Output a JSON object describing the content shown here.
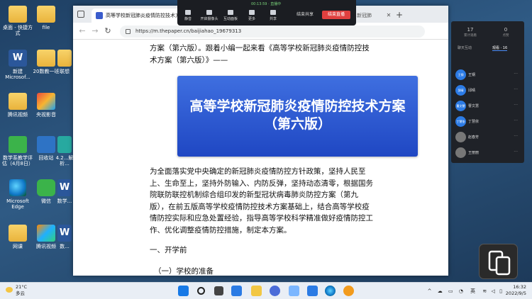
{
  "desktop": {
    "icons": [
      {
        "label": "桌面 - 快捷方式",
        "type": "folder"
      },
      {
        "label": "file",
        "type": "folder"
      },
      {
        "label": "新建 Microsof...",
        "type": "word"
      },
      {
        "label": "20数教一班",
        "type": "folder"
      },
      {
        "label": "联想",
        "type": "folder"
      },
      {
        "label": "腾讯视频",
        "type": "folder"
      },
      {
        "label": "央视影音",
        "type": "app"
      },
      {
        "label": "数学系教学评估（4月8日）",
        "type": "green"
      },
      {
        "label": "回收站",
        "type": "recycle"
      },
      {
        "label": "4.2...解析...",
        "type": "teal"
      },
      {
        "label": "Microsoft Edge",
        "type": "edge"
      },
      {
        "label": "微信",
        "type": "green"
      },
      {
        "label": "数学...",
        "type": "word"
      },
      {
        "label": "网课",
        "type": "folder"
      },
      {
        "label": "腾讯视频",
        "type": "app"
      },
      {
        "label": "数...",
        "type": "word"
      }
    ]
  },
  "browser": {
    "tab_title": "高等学校新冠肺炎疫情防控技术方案（第六版）",
    "tab2_title": "新冠肺",
    "url": "https://m.thepaper.cn/baijiahao_19679313",
    "content": {
      "intro": "方案（第六版）。跟着小编一起来看《高等学校新冠肺炎疫情防控技术方案（第六版）》——",
      "banner_line1": "高等学校新冠肺炎疫情防控技术方案",
      "banner_line2": "（第六版）",
      "body": "为全面落实党中央确定的新冠肺炎疫情防控方针政策，坚持人民至上、生命至上，坚持外防输入、内防反弹，坚持动态清零，根据国务院联防联控机制综合组印发的新型冠状病毒肺炎防控方案（第九版），在前五版高等学校疫情防控技术方案基础上，结合高等学校疫情防控实际和应急处置经验，指导高等学校科学精准做好疫情防控工作、优化调整疫情防控措施，制定本方案。",
      "heading1": "一、开学前",
      "heading2": "（一）学校的准备"
    }
  },
  "meeting": {
    "timer": "00:13:59 · 直播中",
    "tools": [
      "静音",
      "开启摄像头",
      "互动面板",
      "更多",
      "共享"
    ],
    "share_label": "结束共享",
    "end_label": "结束直播"
  },
  "panel": {
    "stat1": {
      "value": "17",
      "label": "累计观看"
    },
    "stat2": {
      "value": "0",
      "label": "点赞"
    },
    "tabs": [
      "聊天互动",
      "观看 · 16"
    ],
    "members": [
      "王钢",
      "邱晴",
      "曹文慧",
      "丁慧依",
      "赵春芳",
      "王丽丽",
      "邱阳"
    ]
  },
  "taskbar": {
    "weather_temp": "21°C",
    "weather_desc": "多云",
    "ime": "英",
    "time": "16:32",
    "date": "2022/9/5"
  }
}
